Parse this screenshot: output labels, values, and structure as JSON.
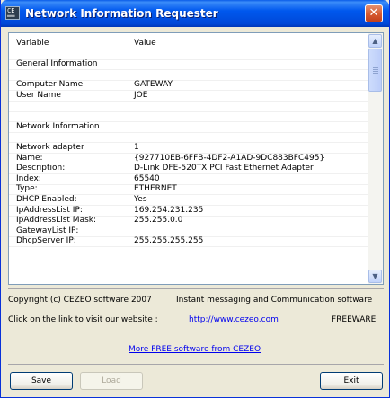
{
  "window": {
    "title": "Network Information Requester",
    "icon_glyph": "CE\n══",
    "close_label": "✕"
  },
  "list": {
    "columns": [
      "Variable",
      "Value"
    ],
    "rows": [
      {
        "variable": "Variable",
        "value": "Value"
      },
      {
        "variable": "",
        "value": ""
      },
      {
        "variable": "General Information",
        "value": ""
      },
      {
        "variable": "",
        "value": ""
      },
      {
        "variable": "Computer Name",
        "value": "GATEWAY"
      },
      {
        "variable": "User Name",
        "value": "JOE"
      },
      {
        "variable": "",
        "value": ""
      },
      {
        "variable": "",
        "value": ""
      },
      {
        "variable": "Network Information",
        "value": ""
      },
      {
        "variable": "",
        "value": ""
      },
      {
        "variable": "Network adapter",
        "value": "1"
      },
      {
        "variable": "Name:",
        "value": "{927710EB-6FFB-4DF2-A1AD-9DC883BFC495}"
      },
      {
        "variable": "Description:",
        "value": "D-Link DFE-520TX PCI Fast Ethernet Adapter"
      },
      {
        "variable": "Index:",
        "value": "65540"
      },
      {
        "variable": "Type:",
        "value": "ETHERNET"
      },
      {
        "variable": "DHCP Enabled:",
        "value": "Yes"
      },
      {
        "variable": "IpAddressList IP:",
        "value": "169.254.231.235"
      },
      {
        "variable": "IpAddressList Mask:",
        "value": "255.255.0.0"
      },
      {
        "variable": "GatewayList IP:",
        "value": ""
      },
      {
        "variable": "DhcpServer IP:",
        "value": "255.255.255.255"
      }
    ],
    "scroll_up_glyph": "▲",
    "scroll_down_glyph": "▼"
  },
  "footer": {
    "copyright": "Copyright (c) CEZEO software 2007",
    "tagline": "Instant messaging and Communication software",
    "visit_text": "Click on the link to visit our website :",
    "website_link": "http://www.cezeo.com",
    "license": "FREEWARE",
    "more_link": "More FREE software from CEZEO"
  },
  "buttons": {
    "save": "Save",
    "load": "Load",
    "exit": "Exit"
  }
}
